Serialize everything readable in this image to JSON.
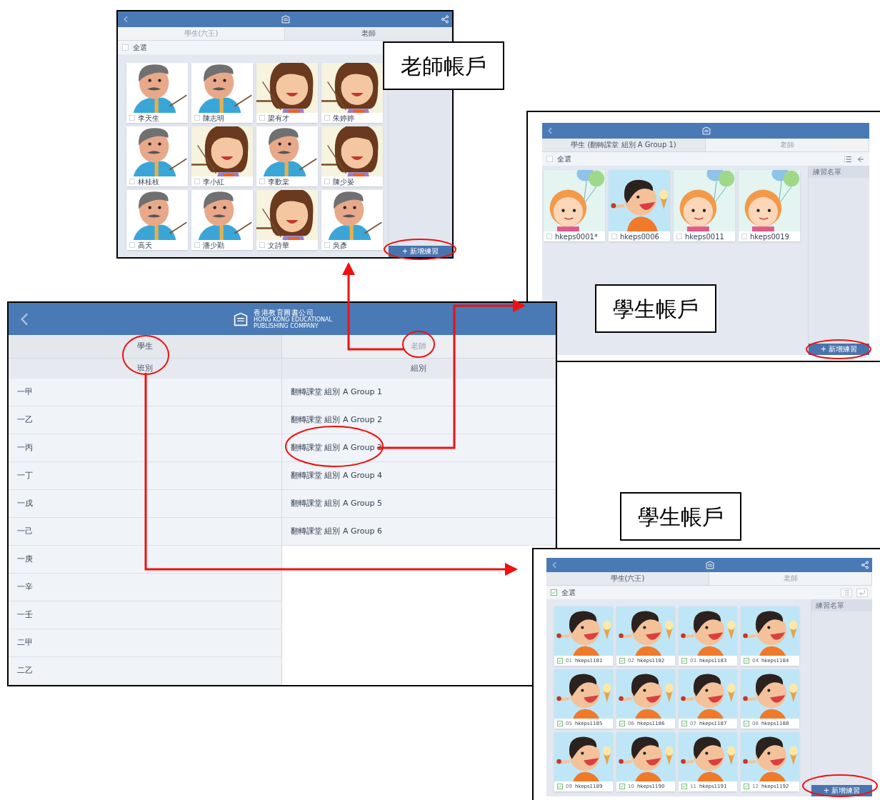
{
  "teacher_screen": {
    "tabs": [
      {
        "label": "學生(六王)",
        "selected": false
      },
      {
        "label": "老師",
        "selected": true
      }
    ],
    "select_all": {
      "label": "全選",
      "checked": false
    },
    "cards": [
      {
        "label": "李天生",
        "kind": "man",
        "checked": false
      },
      {
        "label": "陳志明",
        "kind": "man",
        "checked": false
      },
      {
        "label": "梁有才",
        "kind": "woman",
        "checked": false
      },
      {
        "label": "朱婷婷",
        "kind": "woman",
        "checked": false
      },
      {
        "label": "林桂枝",
        "kind": "man",
        "checked": false
      },
      {
        "label": "李小紅",
        "kind": "woman",
        "checked": false
      },
      {
        "label": "李歡棠",
        "kind": "man",
        "checked": false
      },
      {
        "label": "陳少晏",
        "kind": "woman",
        "checked": false
      },
      {
        "label": "高天",
        "kind": "man",
        "checked": false
      },
      {
        "label": "潘少勤",
        "kind": "man",
        "checked": false
      },
      {
        "label": "文詩華",
        "kind": "woman",
        "checked": false
      },
      {
        "label": "吳彥",
        "kind": "man",
        "checked": false
      }
    ],
    "add_button": "+ 新增練習"
  },
  "teacher_callout": "老師帳戶",
  "group_student_screen": {
    "tabs": [
      {
        "label": "學生 (翻轉課堂 組別 A Group 1)",
        "selected": true
      },
      {
        "label": "老師",
        "selected": false
      }
    ],
    "select_all": {
      "label": "全選",
      "checked": false
    },
    "cards": [
      {
        "label": "hkeps0001*",
        "kind": "girl",
        "checked": false
      },
      {
        "label": "hkeps0006",
        "kind": "boy",
        "checked": false
      },
      {
        "label": "hkeps0011",
        "kind": "girl",
        "checked": false
      },
      {
        "label": "hkeps0019",
        "kind": "girl",
        "checked": false
      }
    ],
    "sidebar_title": "練習名單",
    "add_button": "+ 新增練習",
    "callout": "學生帳戶"
  },
  "main_screen": {
    "logo": {
      "name": "香港教育圖書公司",
      "subtitle_lines": [
        "HONG KONG EDUCATIONAL",
        "PUBLISHING COMPANY"
      ]
    },
    "tabs": [
      {
        "label": "學生",
        "selected": true
      },
      {
        "label": "老師",
        "selected": false
      }
    ],
    "columns": [
      {
        "heading": "班別",
        "rows": [
          "一甲",
          "一乙",
          "一丙",
          "一丁",
          "一戌",
          "一己",
          "一庚",
          "一辛",
          "一壬",
          "二甲",
          "二乙"
        ]
      },
      {
        "heading": "組別",
        "rows": [
          "翻轉課堂 組別 A Group 1",
          "翻轉課堂 組別 A Group 2",
          "翻轉課堂 組別 A Group 3",
          "翻轉課堂 組別 A Group 4",
          "翻轉課堂 組別 A Group 5",
          "翻轉課堂 組別 A Group 6"
        ]
      }
    ]
  },
  "class_callout": "學生帳戶",
  "class_student_screen": {
    "tabs": [
      {
        "label": "學生(六王)",
        "selected": true
      },
      {
        "label": "老師",
        "selected": false
      }
    ],
    "select_all": {
      "label": "全選",
      "checked": true
    },
    "cards": [
      {
        "number": "01",
        "label": "hkeps1181",
        "kind": "boy",
        "checked": true
      },
      {
        "number": "02",
        "label": "hkeps1182",
        "kind": "boy",
        "checked": true
      },
      {
        "number": "03",
        "label": "hkeps1183",
        "kind": "boy",
        "checked": true
      },
      {
        "number": "04",
        "label": "hkeps1184",
        "kind": "boy",
        "checked": true
      },
      {
        "number": "05",
        "label": "hkeps1185",
        "kind": "boy",
        "checked": true
      },
      {
        "number": "06",
        "label": "hkeps1186",
        "kind": "boy",
        "checked": true
      },
      {
        "number": "07",
        "label": "hkeps1187",
        "kind": "boy",
        "checked": true
      },
      {
        "number": "08",
        "label": "hkeps1188",
        "kind": "boy",
        "checked": true
      },
      {
        "number": "09",
        "label": "hkeps1189",
        "kind": "boy",
        "checked": true
      },
      {
        "number": "10",
        "label": "hkeps1190",
        "kind": "boy",
        "checked": true
      },
      {
        "number": "11",
        "label": "hkeps1191",
        "kind": "boy",
        "checked": true
      },
      {
        "number": "12",
        "label": "hkeps1192",
        "kind": "boy",
        "checked": true
      }
    ],
    "sidebar_title": "練習名單",
    "add_button": "+ 新增練習"
  }
}
